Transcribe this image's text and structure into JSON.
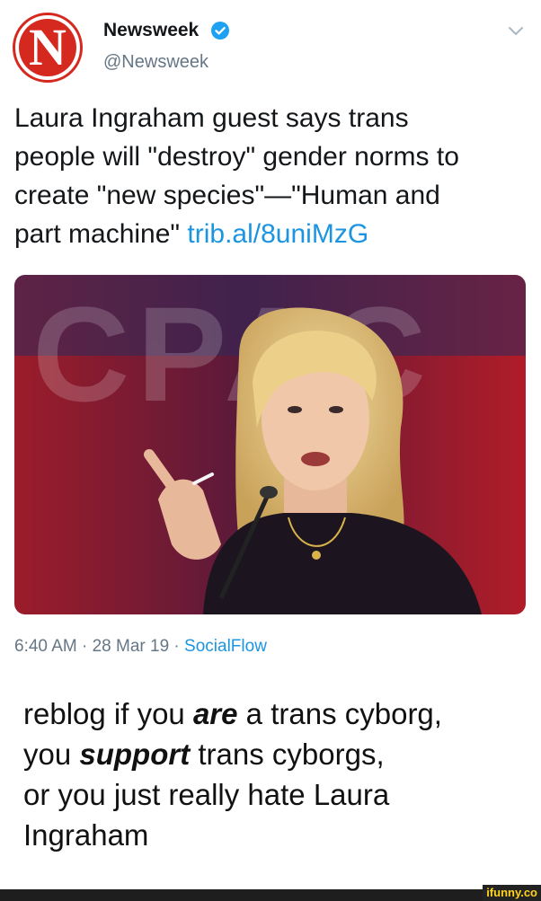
{
  "tweet": {
    "avatar_letter": "N",
    "name": "Newsweek",
    "handle": "@Newsweek",
    "text_parts": {
      "line1": "Laura Ingraham guest says trans",
      "line2": "people will \"destroy\" gender norms to",
      "line3": "create \"new species\"—\"Human and",
      "line4": "part machine\" ",
      "link": "trib.al/8uniMzG"
    },
    "photo_background_text": "CPAC",
    "time": "6:40 AM",
    "sep1": " · ",
    "date": "28 Mar 19",
    "sep2": " · ",
    "source": "SocialFlow",
    "colors": {
      "brand_red": "#d5281e",
      "link_blue": "#1b95e0",
      "meta_gray": "#657786"
    },
    "icons": [
      "newsweek-logo",
      "verified-badge-icon",
      "chevron-down-icon"
    ]
  },
  "caption": {
    "p1_a": "reblog if you ",
    "p1_em": "are",
    "p1_b": " a trans cyborg,",
    "p2_a": "you ",
    "p2_em": "support",
    "p2_b": " trans cyborgs,",
    "p3": "or you just really hate Laura",
    "p4": "Ingraham"
  },
  "watermark": "ifunny.co"
}
